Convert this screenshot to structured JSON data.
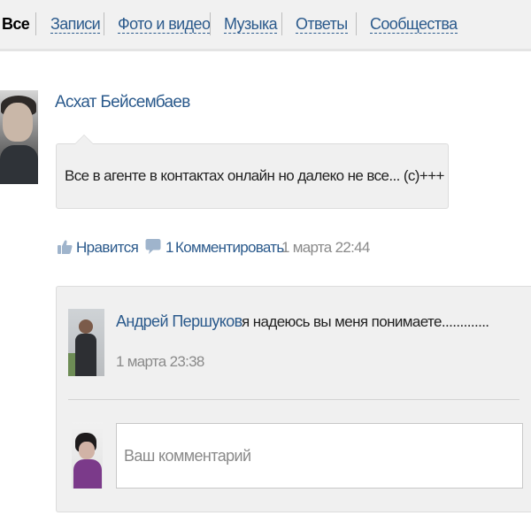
{
  "tabs": {
    "items": [
      {
        "label": "Все",
        "active": true
      },
      {
        "label": "Записи",
        "active": false
      },
      {
        "label": "Фото и видео",
        "active": false
      },
      {
        "label": "Музыка",
        "active": false
      },
      {
        "label": "Ответы",
        "active": false
      },
      {
        "label": "Сообщества",
        "active": false
      }
    ]
  },
  "post": {
    "author": "Асхат Бейсембаев",
    "text": "Все в агенте в контактах онлайн но далеко не все... (с)+++",
    "actions": {
      "like_label": "Нравится",
      "comment_count": "1",
      "comment_label": "Комментировать",
      "date": "1 марта 22:44",
      "like_icon": "thumbs-up-icon",
      "comment_icon": "speech-bubble-icon"
    }
  },
  "comments": [
    {
      "author": "Андрей Першуков",
      "text": "я надеюсь вы меня понимаете.............",
      "date": "1 марта 23:38"
    }
  ],
  "reply": {
    "placeholder": "Ваш комментарий"
  },
  "colors": {
    "link": "#2b5a8c",
    "muted": "#8a8a8a",
    "panel": "#f0f0f0",
    "icon": "#9fb4cc"
  }
}
